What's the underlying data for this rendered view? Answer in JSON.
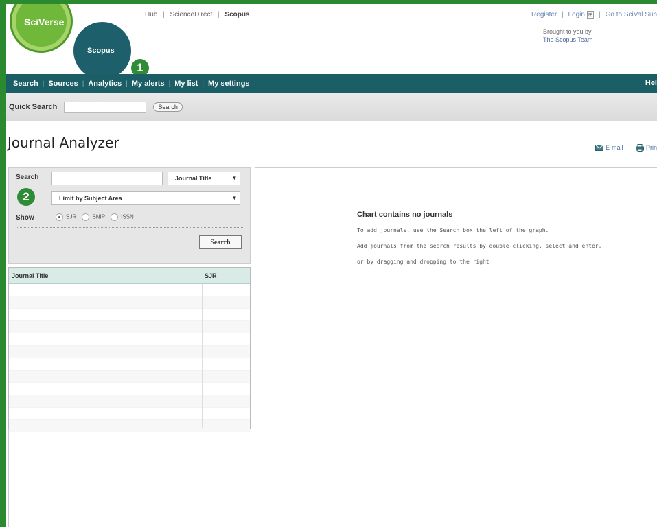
{
  "header": {
    "logo_sciverse": "SciVerse",
    "logo_scopus": "Scopus",
    "hub_links": [
      "Hub",
      "ScienceDirect",
      "Scopus"
    ],
    "top_right": {
      "register": "Register",
      "login": "Login",
      "goto": "Go to SciVal Sub"
    },
    "brought_by": "Brought to you by",
    "team": "The Scopus Team"
  },
  "badges": {
    "one": "1",
    "two": "2"
  },
  "nav": {
    "items": [
      "Search",
      "Sources",
      "Analytics",
      "My alerts",
      "My list",
      "My settings"
    ],
    "help": "Hel"
  },
  "quick_search": {
    "label": "Quick Search",
    "button": "Search"
  },
  "page": {
    "title": "Journal Analyzer",
    "email": "E-mail",
    "print": "Prin"
  },
  "left_panel": {
    "search_label": "Search",
    "search_type": "Journal Title",
    "subject_area": "Limit by Subject Area",
    "show_label": "Show",
    "show_options": [
      "SJR",
      "SNIP",
      "ISSN"
    ],
    "selected_option": "SJR",
    "search_button": "Search"
  },
  "results": {
    "columns": [
      "Journal Title",
      "SJR"
    ],
    "rows": []
  },
  "chart_area": {
    "title": "Chart contains no journals",
    "lines": [
      "To add journals, use the Search box the left of the graph.",
      "Add journals from the search results by double-clicking, select and enter,",
      "or by dragging and dropping to the right"
    ]
  }
}
